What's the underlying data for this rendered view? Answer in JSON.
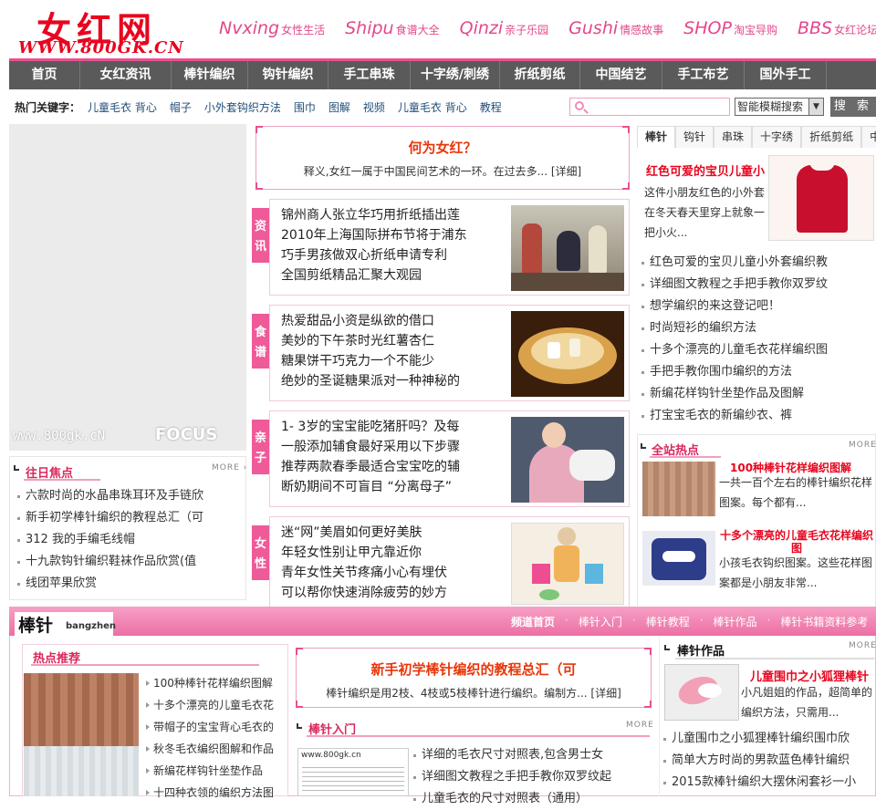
{
  "header": {
    "logo_cn": "女红网",
    "logo_url": "WWW.800GK.CN",
    "top_links": [
      {
        "en": "Nvxing",
        "zh": "女性生活"
      },
      {
        "en": "Shipu",
        "zh": "食谱大全"
      },
      {
        "en": "Qinzi",
        "zh": "亲子乐园"
      },
      {
        "en": "Gushi",
        "zh": "情感故事"
      },
      {
        "en": "SHOP",
        "zh": "淘宝导购"
      },
      {
        "en": "BBS",
        "zh": "女红论坛"
      }
    ]
  },
  "nav": [
    "首页",
    "女红资讯",
    "棒针编织",
    "钩针编织",
    "手工串珠",
    "十字绣/刺绣",
    "折纸剪纸",
    "中国结艺",
    "手工布艺",
    "国外手工"
  ],
  "hot": {
    "label": "热门关键字：",
    "keywords": [
      "儿童毛衣 背心",
      "帽子",
      "小外套钩织方法",
      "围巾",
      "图解",
      "视频",
      "儿童毛衣 背心",
      "教程"
    ],
    "search_placeholder": "",
    "search_mode": "智能模糊搜索",
    "search_button": "搜 索"
  },
  "focus": {
    "watermark": "www.800gk.cN",
    "brand": "FOCUS"
  },
  "past": {
    "title": "往日焦点",
    "more": "MORE",
    "items": [
      "六款时尚的水晶串珠耳环及手链欣",
      "新手初学棒针编织的教程总汇（可",
      "312 我的手编毛线帽",
      "十九款钩针编织鞋袜作品欣赏(值",
      "线团苹果欣赏"
    ]
  },
  "what": {
    "title": "何为女红？",
    "desc": "释义,女红一属于中国民间艺术的一环。在过去多... [详细]"
  },
  "cats": [
    {
      "label": "资讯",
      "items": [
        "锦州商人张立华巧用折纸插出莲",
        "2010年上海国际拼布节将于浦东",
        "巧手男孩做双心折纸申请专利",
        "全国剪纸精品汇聚大观园"
      ]
    },
    {
      "label": "食谱",
      "items": [
        "热爱甜品小资是纵欲的借口",
        "美妙的下午茶时光红薯杏仁",
        "糖果饼干巧克力一个不能少",
        "绝妙的圣诞糖果派对一种神秘的"
      ]
    },
    {
      "label": "亲子",
      "items": [
        "1- 3岁的宝宝能吃猪肝吗？及每",
        "一般添加辅食最好采用以下步骤",
        "推荐两款春季最适合宝宝吃的辅",
        "断奶期间不可盲目 “分离母子”"
      ]
    },
    {
      "label": "女性",
      "items": [
        "迷“网”美眉如何更好美肤",
        "年轻女性别让甲亢靠近你",
        "青年女性关节疼痛小心有埋伏",
        "可以帮你快速消除疲劳的妙方"
      ]
    }
  ],
  "right": {
    "tabs": [
      "棒针",
      "钩针",
      "串珠",
      "十字绣",
      "折纸剪纸",
      "中国结"
    ],
    "feature_title": "红色可爱的宝贝儿童小",
    "feature_desc": "这件小朋友红色的小外套在冬天春天里穿上就象一把小火...",
    "items": [
      "红色可爱的宝贝儿童小外套编织教",
      "详细图文教程之手把手教你双罗纹",
      "想学编织的来这登记吧！",
      "时尚短衫的编织方法",
      "十多个漂亮的儿童毛衣花样编织图",
      "手把手教你围巾编织的方法",
      "新编花样钩针坐垫作品及图解",
      "打宝宝毛衣的新编纱衣、裤"
    ],
    "hot_title": "全站热点",
    "more": "MORE",
    "hot1_title": "100种棒针花样编织图解",
    "hot1_desc": "一共一百个左右的棒针编织花样图案。每个都有...",
    "hot2_title": "十多个漂亮的儿童毛衣花样编织图",
    "hot2_desc": "小孩毛衣钩织图案。这些花样图案都是小朋友非常..."
  },
  "band": {
    "name_zh": "棒针",
    "name_py": "bangzhen",
    "links": [
      "频道首页",
      "棒针入门",
      "棒针教程",
      "棒针作品",
      "棒针书籍资料参考"
    ],
    "hot_title": "热点推荐",
    "hot_items": [
      "100种棒针花样编织图解",
      "十多个漂亮的儿童毛衣花",
      "带帽子的宝宝背心毛衣的",
      "秋冬毛衣编织图解和作品",
      "新编花样钩针坐垫作品",
      "十四种衣领的编织方法图"
    ],
    "center_title": "新手初学棒针编织的教程总汇（可",
    "center_desc": "棒针编织是用2枝、4枝或5枝棒针进行编织。编制方... [详细]",
    "intro_title": "棒针入门",
    "more": "MORE",
    "intro_items": [
      "详细的毛衣尺寸对照表,包含男士女",
      "详细图文教程之手把手教你双罗纹起",
      "儿童毛衣的尺寸对照表（通用）"
    ],
    "chart_wm": "www.800gk.cn",
    "works_title": "棒针作品",
    "works_feature_title": "儿童围巾之小狐狸棒针",
    "works_feature_desc": "小凡姐姐的作品，超简单的编织方法，只需用...",
    "works_items": [
      "儿童围巾之小狐狸棒针编织围巾欣",
      "简单大方时尚的男款蓝色棒针编织",
      "2015款棒针编织大摆休闲套衫一小"
    ]
  },
  "colors": {
    "brand_red": "#e8051f",
    "pink": "#ef5a98",
    "nav_gray": "#5a5a5a"
  }
}
